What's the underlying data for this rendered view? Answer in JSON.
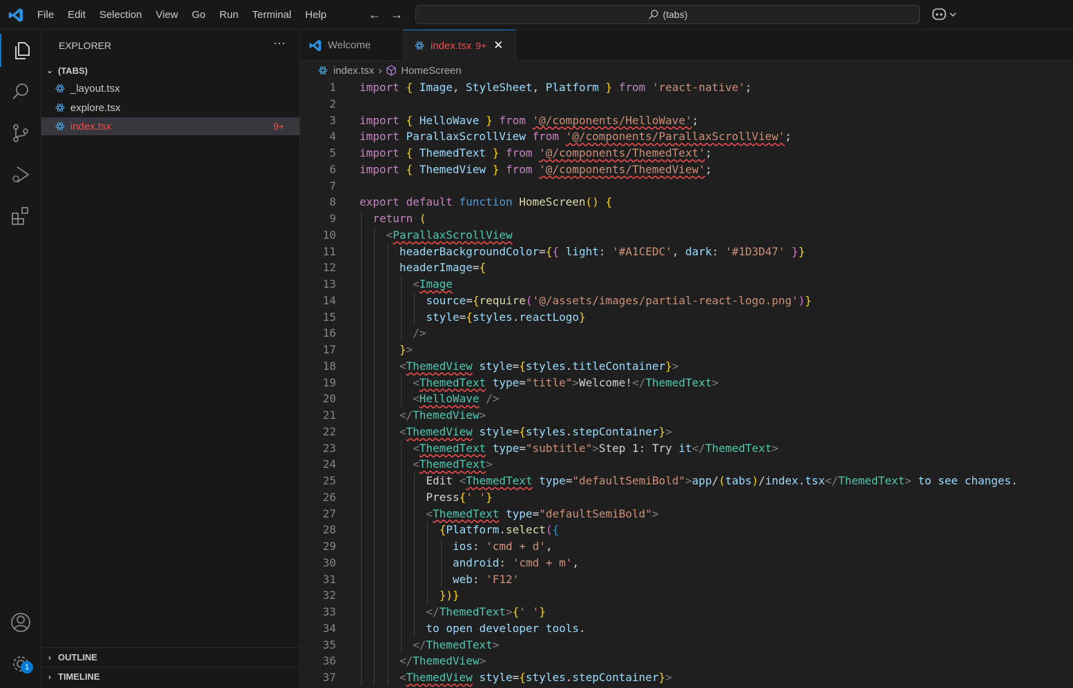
{
  "menu": [
    "File",
    "Edit",
    "Selection",
    "View",
    "Go",
    "Run",
    "Terminal",
    "Help"
  ],
  "search": {
    "text": "(tabs)"
  },
  "explorer": {
    "title": "EXPLORER",
    "folder": "(TABS)",
    "files": [
      {
        "name": "_layout.tsx",
        "badge": ""
      },
      {
        "name": "explore.tsx",
        "badge": ""
      },
      {
        "name": "index.tsx",
        "badge": "9+"
      }
    ],
    "outline": "OUTLINE",
    "timeline": "TIMELINE"
  },
  "activity_badge": "1",
  "tabs": [
    {
      "label": "Welcome",
      "badge": ""
    },
    {
      "label": "index.tsx",
      "badge": "9+"
    }
  ],
  "breadcrumb": {
    "file": "index.tsx",
    "symbol": "HomeScreen"
  },
  "colors": {
    "accent": "#0078d4",
    "error": "#f14c4c",
    "background": "#1f1f1f"
  },
  "code_lines": [
    "import { Image, StyleSheet, Platform } from 'react-native';",
    "",
    "import { HelloWave } from '@/components/HelloWave';",
    "import ParallaxScrollView from '@/components/ParallaxScrollView';",
    "import { ThemedText } from '@/components/ThemedText';",
    "import { ThemedView } from '@/components/ThemedView';",
    "",
    "export default function HomeScreen() {",
    "  return (",
    "    <ParallaxScrollView",
    "      headerBackgroundColor={{ light: '#A1CEDC', dark: '#1D3D47' }}",
    "      headerImage={",
    "        <Image",
    "          source={require('@/assets/images/partial-react-logo.png')}",
    "          style={styles.reactLogo}",
    "        />",
    "      }>",
    "      <ThemedView style={styles.titleContainer}>",
    "        <ThemedText type=\"title\">Welcome!</ThemedText>",
    "        <HelloWave />",
    "      </ThemedView>",
    "      <ThemedView style={styles.stepContainer}>",
    "        <ThemedText type=\"subtitle\">Step 1: Try it</ThemedText>",
    "        <ThemedText>",
    "          Edit <ThemedText type=\"defaultSemiBold\">app/(tabs)/index.tsx</ThemedText> to see changes.",
    "          Press{' '}",
    "          <ThemedText type=\"defaultSemiBold\">",
    "            {Platform.select({",
    "              ios: 'cmd + d',",
    "              android: 'cmd + m',",
    "              web: 'F12'",
    "            })}",
    "          </ThemedText>{' '}",
    "          to open developer tools.",
    "        </ThemedText>",
    "      </ThemedView>",
    "      <ThemedView style={styles.stepContainer}>"
  ]
}
